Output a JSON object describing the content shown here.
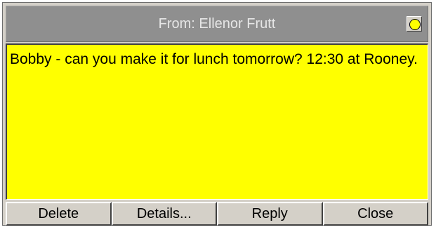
{
  "window": {
    "title": "From: Ellenor Frutt",
    "title_button_icon": "yellow-circle-icon"
  },
  "message": {
    "text": "Bobby - can you make it for lunch tomorrow? 12:30 at Rooney."
  },
  "buttons": {
    "delete": "Delete",
    "details": "Details...",
    "reply": "Reply",
    "close": "Close"
  },
  "colors": {
    "note_background": "#ffff00",
    "titlebar": "#8f8f8f",
    "button_face": "#d4d0c8"
  }
}
